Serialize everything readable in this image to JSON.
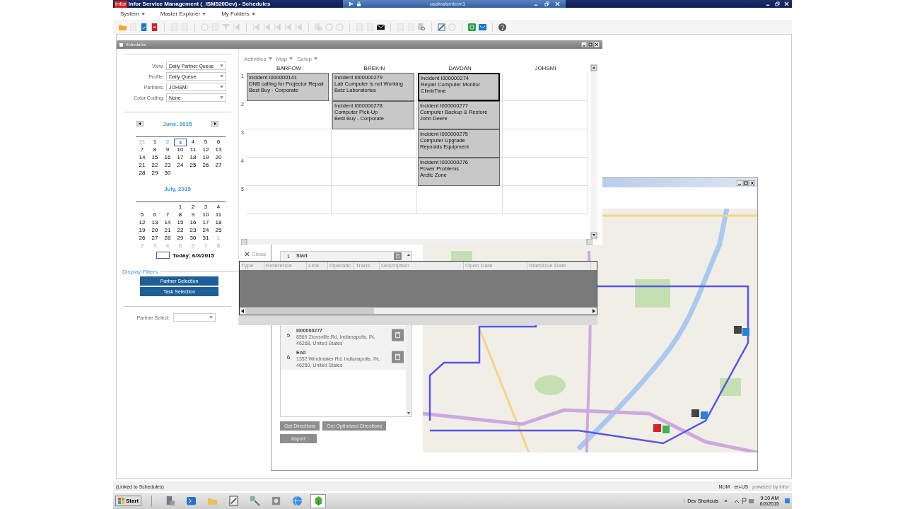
{
  "title_bar": {
    "logo": "infor",
    "title": "Infor Service Management (_ISM520Dev) - Schedules"
  },
  "remote_bar": {
    "host": "usalvwismterm1"
  },
  "menu": [
    {
      "label": "System"
    },
    {
      "label": "Master Explorer"
    },
    {
      "label": "My Folders"
    }
  ],
  "toolbar": [
    [
      {
        "kind": "folder",
        "disabled": false
      },
      {
        "kind": "page",
        "disabled": true
      },
      {
        "kind": "doc",
        "disabled": false
      },
      {
        "kind": "pdf",
        "disabled": false
      }
    ],
    [
      {
        "kind": "page",
        "disabled": true
      },
      {
        "kind": "page",
        "disabled": true
      }
    ],
    [
      {
        "kind": "circle",
        "disabled": true
      },
      {
        "kind": "page",
        "disabled": true
      },
      {
        "kind": "filter",
        "disabled": true
      },
      {
        "kind": "arrow",
        "disabled": true
      }
    ],
    [
      {
        "kind": "arrow",
        "disabled": true
      },
      {
        "kind": "arrow",
        "disabled": true
      },
      {
        "kind": "arrow",
        "disabled": true
      },
      {
        "kind": "arrow",
        "disabled": true
      },
      {
        "kind": "arrow",
        "disabled": true
      }
    ],
    [
      {
        "kind": "search",
        "disabled": true
      },
      {
        "kind": "circle",
        "disabled": true
      },
      {
        "kind": "circle",
        "disabled": true
      }
    ],
    [
      {
        "kind": "page",
        "disabled": true
      },
      {
        "kind": "page",
        "disabled": true
      },
      {
        "kind": "mail",
        "disabled": false
      }
    ],
    [
      {
        "kind": "page",
        "disabled": true
      },
      {
        "kind": "page",
        "disabled": true
      },
      {
        "kind": "search",
        "disabled": false
      }
    ],
    [
      {
        "kind": "edit",
        "disabled": false
      },
      {
        "kind": "circle",
        "disabled": true
      }
    ],
    [
      {
        "kind": "link",
        "disabled": false
      },
      {
        "kind": "mailblue",
        "disabled": false
      }
    ],
    [
      {
        "kind": "help",
        "disabled": false
      }
    ]
  ],
  "schedules": {
    "title": "Schedules",
    "filters": [
      {
        "label": "View:",
        "value": "Daily Partner Queue"
      },
      {
        "label": "Profile:",
        "value": "Daily Queue"
      },
      {
        "label": "Partners:",
        "value": "JOHSMI"
      },
      {
        "label": "Color Coding:",
        "value": "None"
      }
    ],
    "calendars": [
      {
        "month": "June, 2015",
        "nav": true,
        "weeks": [
          [
            {
              "kind": "other",
              "text": "31"
            },
            {
              "kind": "day",
              "text": "1"
            },
            {
              "kind": "marked",
              "text": "2"
            },
            {
              "kind": "today",
              "text": "3"
            },
            {
              "kind": "day",
              "text": "4"
            },
            {
              "kind": "day",
              "text": "5"
            },
            {
              "kind": "day",
              "text": "6"
            }
          ],
          [
            {
              "kind": "day",
              "text": "7"
            },
            {
              "kind": "day",
              "text": "8"
            },
            {
              "kind": "day",
              "text": "9"
            },
            {
              "kind": "day",
              "text": "10"
            },
            {
              "kind": "day",
              "text": "11"
            },
            {
              "kind": "day",
              "text": "12"
            },
            {
              "kind": "day",
              "text": "13"
            }
          ],
          [
            {
              "kind": "day",
              "text": "14"
            },
            {
              "kind": "day",
              "text": "15"
            },
            {
              "kind": "day",
              "text": "16"
            },
            {
              "kind": "day",
              "text": "17"
            },
            {
              "kind": "day",
              "text": "18"
            },
            {
              "kind": "day",
              "text": "19"
            },
            {
              "kind": "day",
              "text": "20"
            }
          ],
          [
            {
              "kind": "day",
              "text": "21"
            },
            {
              "kind": "day",
              "text": "22"
            },
            {
              "kind": "day",
              "text": "23"
            },
            {
              "kind": "day",
              "text": "24"
            },
            {
              "kind": "day",
              "text": "25"
            },
            {
              "kind": "day",
              "text": "26"
            },
            {
              "kind": "day",
              "text": "27"
            }
          ],
          [
            {
              "kind": "day",
              "text": "28"
            },
            {
              "kind": "day",
              "text": "29"
            },
            {
              "kind": "day",
              "text": "30"
            }
          ]
        ]
      },
      {
        "month": "July, 2015",
        "nav": false,
        "weeks": [
          [
            {
              "kind": "blank"
            },
            {
              "kind": "blank"
            },
            {
              "kind": "blank"
            },
            {
              "kind": "day",
              "text": "1"
            },
            {
              "kind": "day",
              "text": "2"
            },
            {
              "kind": "day",
              "text": "3"
            },
            {
              "kind": "day",
              "text": "4"
            }
          ],
          [
            {
              "kind": "day",
              "text": "5"
            },
            {
              "kind": "day",
              "text": "6"
            },
            {
              "kind": "day",
              "text": "7"
            },
            {
              "kind": "day",
              "text": "8"
            },
            {
              "kind": "day",
              "text": "9"
            },
            {
              "kind": "day",
              "text": "10"
            },
            {
              "kind": "day",
              "text": "11"
            }
          ],
          [
            {
              "kind": "day",
              "text": "12"
            },
            {
              "kind": "day",
              "text": "13"
            },
            {
              "kind": "day",
              "text": "14"
            },
            {
              "kind": "day",
              "text": "15"
            },
            {
              "kind": "day",
              "text": "16"
            },
            {
              "kind": "day",
              "text": "17"
            },
            {
              "kind": "day",
              "text": "18"
            }
          ],
          [
            {
              "kind": "day",
              "text": "19"
            },
            {
              "kind": "day",
              "text": "20"
            },
            {
              "kind": "day",
              "text": "21"
            },
            {
              "kind": "day",
              "text": "22"
            },
            {
              "kind": "day",
              "text": "23"
            },
            {
              "kind": "day",
              "text": "24"
            },
            {
              "kind": "day",
              "text": "25"
            }
          ],
          [
            {
              "kind": "day",
              "text": "26"
            },
            {
              "kind": "day",
              "text": "27"
            },
            {
              "kind": "day",
              "text": "28"
            },
            {
              "kind": "day",
              "text": "29"
            },
            {
              "kind": "day",
              "text": "30"
            },
            {
              "kind": "day",
              "text": "31"
            },
            {
              "kind": "other",
              "text": "1"
            }
          ],
          [
            {
              "kind": "other",
              "text": "2"
            },
            {
              "kind": "other",
              "text": "3"
            },
            {
              "kind": "other",
              "text": "4"
            },
            {
              "kind": "other",
              "text": "5"
            },
            {
              "kind": "other",
              "text": "6"
            },
            {
              "kind": "other",
              "text": "7"
            },
            {
              "kind": "other",
              "text": "8"
            }
          ]
        ]
      }
    ],
    "today": "Today: 6/3/2015",
    "display_filters": {
      "title": "Display Filters",
      "buttons": [
        "Partner Selection",
        "Task Selection"
      ]
    },
    "partner_select": {
      "label": "Partner Select:"
    },
    "grid_menu": [
      "Activities",
      "Map",
      "Setup"
    ],
    "row_labels": [
      "1",
      "2",
      "3",
      "4",
      "5"
    ],
    "columns": [
      {
        "name": "BARFOW",
        "cards": [
          {
            "lines": [
              "Incident I000000141",
              "DNB calling for Projector Repair",
              "Best Buy - Corporate"
            ],
            "selected": false
          }
        ]
      },
      {
        "name": "BREKIN",
        "cards": [
          {
            "lines": [
              "Incident I000000279",
              "Lab Computer is not Working",
              "Betz Laboratories"
            ],
            "selected": false
          },
          {
            "lines": [
              "Incident I000000278",
              "Computer Pick-Up",
              "Best Buy - Corporate"
            ],
            "selected": false
          }
        ]
      },
      {
        "name": "DAVDAN",
        "cards": [
          {
            "lines": [
              "Incident I000000274",
              "Repair Computer Monitor",
              "ClimbTime"
            ],
            "selected": true
          },
          {
            "lines": [
              "Incident I000000277",
              "Computer Backup & Restore",
              "John Deere"
            ],
            "selected": false
          },
          {
            "lines": [
              "Incident I000000275",
              "Computer Upgrade",
              "Reynolds Equipment"
            ],
            "selected": false
          },
          {
            "lines": [
              "Incident I000000276",
              "Power Problems",
              "Arctic Zone"
            ],
            "selected": false
          }
        ]
      },
      {
        "name": "JOHSMI"
      }
    ]
  },
  "detail": {
    "close": "Close",
    "columns": [
      "Type",
      "Reference",
      "Line",
      "Operatic",
      "Trans",
      "Description",
      "Open Date",
      "Start/Due Date"
    ]
  },
  "map_window": {
    "stops": [
      {
        "number": "1",
        "title": "Start"
      },
      {
        "number": "5",
        "title": "I000000277",
        "address": "8569 Zionsville Rd, Indianapolis, IN, 46268, United States"
      },
      {
        "number": "6",
        "title": "End",
        "address": "1352 Windmaker Rd, Indianapolis, IN, 46250, United States"
      }
    ],
    "buttons": [
      "Get Directions",
      "Get Optimized Directions"
    ],
    "import": "Import"
  },
  "status_bar": {
    "text": "(Linked to Schedules)",
    "num": "NUM",
    "locale": "en-US",
    "brand": "powered by infor"
  },
  "taskbar": {
    "start": "Start",
    "apps": [
      {
        "kind": "server",
        "selected": false
      },
      {
        "kind": "shell",
        "selected": false
      },
      {
        "kind": "folder",
        "selected": false
      },
      {
        "kind": "notepad",
        "selected": false
      },
      {
        "kind": "tools",
        "selected": false
      },
      {
        "kind": "vault",
        "selected": false
      },
      {
        "kind": "globe",
        "selected": false
      },
      {
        "kind": "box",
        "selected": true
      }
    ],
    "shortcuts": "Dev Shortcuts",
    "chevron": "»",
    "time": "9:10 AM",
    "date": "6/3/2015"
  }
}
